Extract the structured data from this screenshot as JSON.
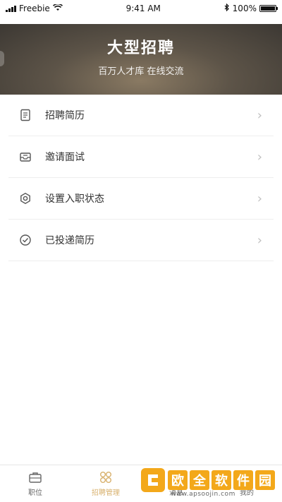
{
  "status": {
    "carrier": "Freebie",
    "time": "9:41 AM",
    "battery": "100%"
  },
  "hero": {
    "title": "大型招聘",
    "subtitle": "百万人才库 在线交流"
  },
  "menu": [
    {
      "label": "招聘简历",
      "icon": "resume-icon"
    },
    {
      "label": "邀请面试",
      "icon": "inbox-icon"
    },
    {
      "label": "设置入职状态",
      "icon": "gear-icon"
    },
    {
      "label": "已投递简历",
      "icon": "check-circle-icon"
    }
  ],
  "tabs": [
    {
      "label": "职位",
      "icon": "briefcase-icon",
      "active": false
    },
    {
      "label": "招聘管理",
      "icon": "grid-icon",
      "active": true
    },
    {
      "label": "消息",
      "icon": "message-icon",
      "active": false
    },
    {
      "label": "我的",
      "icon": "person-icon",
      "active": false
    }
  ],
  "watermark": {
    "text": "欧全软件园",
    "url": "www.apsoojin.com"
  },
  "colors": {
    "accent": "#d8b16d",
    "watermark": "#f3a81a"
  }
}
